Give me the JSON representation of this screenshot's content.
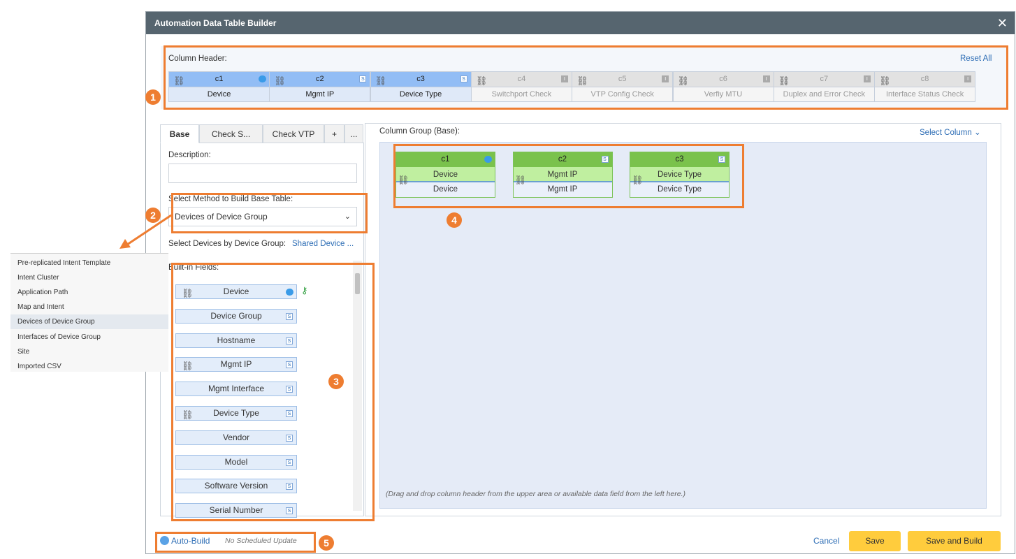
{
  "window": {
    "title": "Automation Data Table Builder",
    "close_icon": "close-icon"
  },
  "column_header": {
    "label": "Column Header:",
    "reset_all": "Reset All",
    "columns": [
      {
        "id": "c1",
        "name": "Device",
        "type": "device",
        "active": true
      },
      {
        "id": "c2",
        "name": "Mgmt IP",
        "type": "S",
        "active": true
      },
      {
        "id": "c3",
        "name": "Device Type",
        "type": "S",
        "active": true
      },
      {
        "id": "c4",
        "name": "Switchport Check",
        "type": "I",
        "active": false
      },
      {
        "id": "c5",
        "name": "VTP Config Check",
        "type": "I",
        "active": false
      },
      {
        "id": "c6",
        "name": "Verfiy MTU",
        "type": "I",
        "active": false
      },
      {
        "id": "c7",
        "name": "Duplex and Error Check",
        "type": "I",
        "active": false
      },
      {
        "id": "c8",
        "name": "Interface Status Check",
        "type": "I",
        "active": false
      }
    ]
  },
  "tabs": [
    {
      "label": "Base"
    },
    {
      "label": "Check S..."
    },
    {
      "label": "Check VTP"
    },
    {
      "label": "+"
    },
    {
      "label": "..."
    }
  ],
  "left": {
    "description_label": "Description:",
    "description_value": "",
    "method_label": "Select Method to Build Base Table:",
    "method_value": "Devices of Device Group",
    "group_label": "Select Devices by Device Group:",
    "group_value": "Shared Device ...",
    "fields_label": "Built-in Fields:",
    "fields": [
      {
        "name": "Device",
        "type": "device",
        "chain": true,
        "key": true
      },
      {
        "name": "Device Group",
        "type": "S"
      },
      {
        "name": "Hostname",
        "type": "S"
      },
      {
        "name": "Mgmt IP",
        "type": "S",
        "chain": true
      },
      {
        "name": "Mgmt Interface",
        "type": "S"
      },
      {
        "name": "Device Type",
        "type": "S",
        "chain": true
      },
      {
        "name": "Vendor",
        "type": "S"
      },
      {
        "name": "Model",
        "type": "S"
      },
      {
        "name": "Software Version",
        "type": "S"
      },
      {
        "name": "Serial Number",
        "type": "S"
      }
    ]
  },
  "dropdown": {
    "options": [
      "Pre-replicated Intent Template",
      "Intent Cluster",
      "Application Path",
      "Map and Intent",
      "Devices of Device Group",
      "Interfaces of Device Group",
      "Site",
      "Imported CSV"
    ],
    "selected": "Devices of Device Group"
  },
  "right": {
    "title": "Column Group (Base):",
    "select_column": "Select Column",
    "cards": [
      {
        "id": "c1",
        "name": "Device",
        "value": "Device",
        "type": "device"
      },
      {
        "id": "c2",
        "name": "Mgmt IP",
        "value": "Mgmt IP",
        "type": "S"
      },
      {
        "id": "c3",
        "name": "Device Type",
        "value": "Device Type",
        "type": "S"
      }
    ],
    "hint": "(Drag and drop column header from the upper area or available data field from the left here.)"
  },
  "footer": {
    "auto_build": "Auto-Build",
    "schedule": "No Scheduled Update",
    "cancel": "Cancel",
    "save": "Save",
    "save_build": "Save and Build"
  },
  "annotations": [
    "1",
    "2",
    "3",
    "4",
    "5"
  ],
  "colors": {
    "accent": "#ee7d31",
    "title_bar": "#56656f",
    "button": "#ffcc3d",
    "link": "#2d6db5"
  }
}
